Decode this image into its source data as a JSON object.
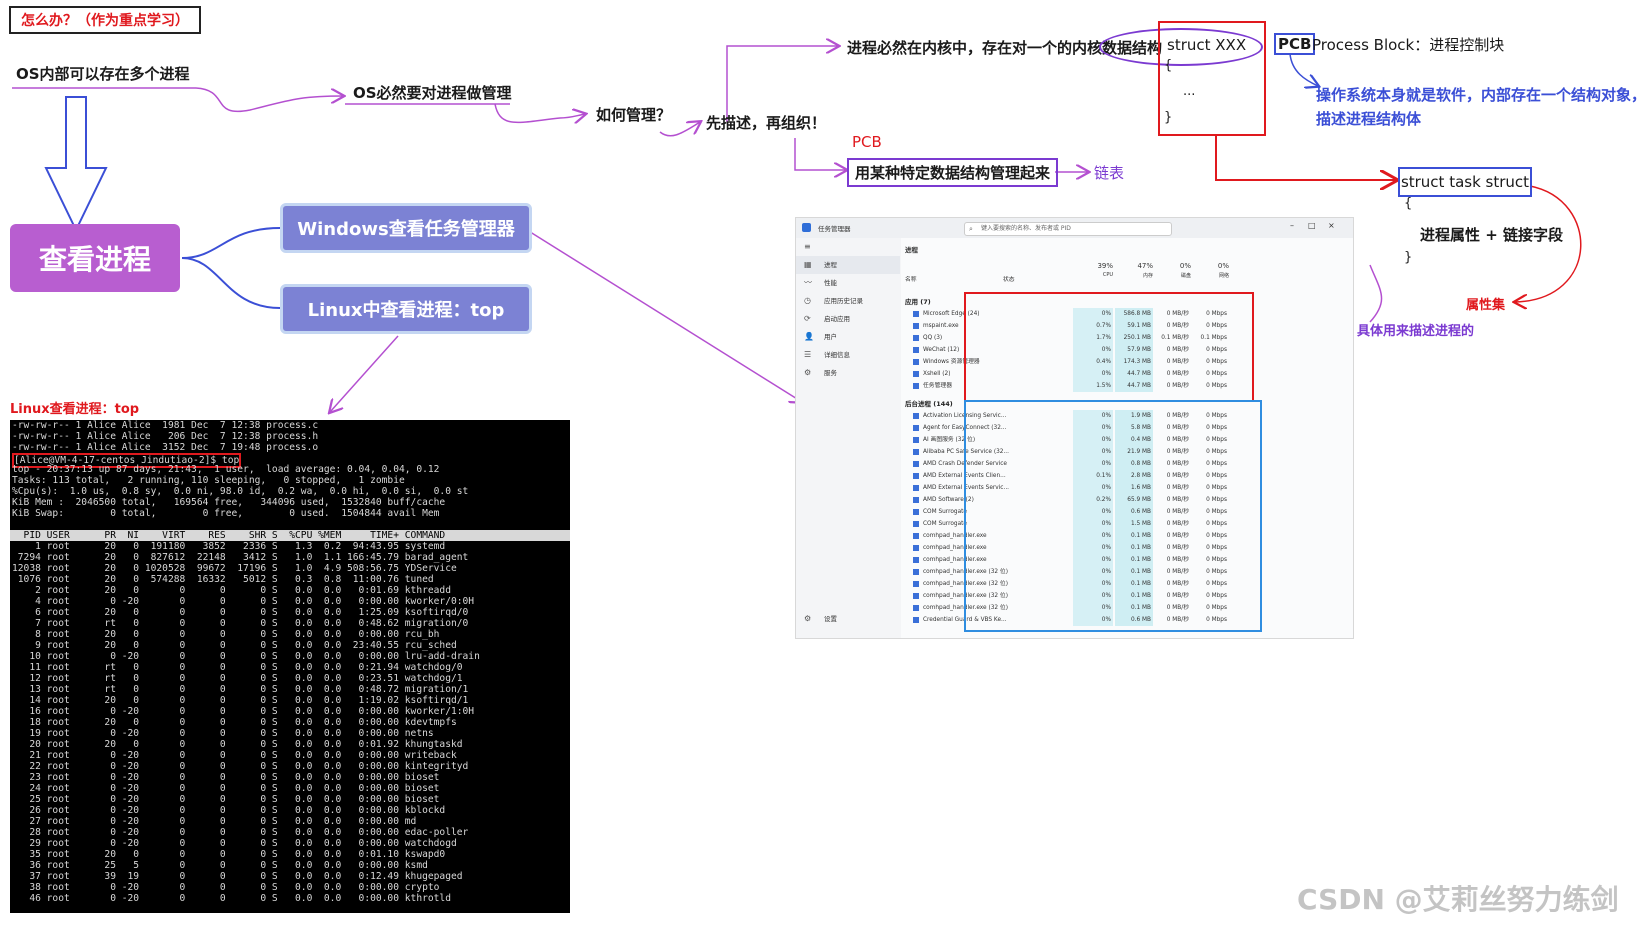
{
  "notes": {
    "title": "怎么办？（作为重点学习）",
    "os_multi": "OS内部可以存在多个进程",
    "os_manage": "OS必然要对进程做管理",
    "how_manage": "如何管理？",
    "describe_organize": "先描述，再组织！",
    "in_kernel": "进程必然在内核中，存在对一个的内核数据结构",
    "struct_xxx": "struct XXX",
    "struct_open": "{",
    "struct_dots": "...",
    "struct_close": "}",
    "pcb_label": "PCB",
    "pcb_desc": "Process Block：进程控制块",
    "os_software_1": "操作系统本身就是软件，内部存在一个结构对象，",
    "os_software_2": "描述进程结构体",
    "pcb_red": "PCB",
    "use_structure": "用某种特定数据结构管理起来",
    "linked_list": "链表",
    "task_struct": "struct task struct",
    "ts_open": "{",
    "ts_body": "进程属性 + 链接字段",
    "ts_close": "}",
    "attr_set": "属性集",
    "concrete_desc": "具体用来描述进程的",
    "view_process": "查看进程",
    "windows_tm": "Windows查看任务管理器",
    "linux_top": "Linux中查看进程：top",
    "linux_view_label": "Linux查看进程：top",
    "watermark": "CSDN @艾莉丝努力练剑"
  },
  "terminal": {
    "ls_lines": [
      "-rw-rw-r-- 1 Alice Alice  1981 Dec  7 12:38 process.c",
      "-rw-rw-r-- 1 Alice Alice   206 Dec  7 12:38 process.h",
      "-rw-rw-r-- 1 Alice Alice  3152 Dec  7 19:48 process.o"
    ],
    "prompt": "[Alice@VM-4-17-centos Jindutiao-2]$ top",
    "summary": [
      "top - 20:37:13 up 87 days, 21:43,  1 user,  load average: 0.04, 0.04, 0.12",
      "Tasks: 113 total,   2 running, 110 sleeping,   0 stopped,   1 zombie",
      "%Cpu(s):  1.0 us,  0.8 sy,  0.0 ni, 98.0 id,  0.2 wa,  0.0 hi,  0.0 si,  0.0 st",
      "KiB Mem :  2046500 total,   169564 free,   344096 used,  1532840 buff/cache",
      "KiB Swap:        0 total,        0 free,        0 used.  1504844 avail Mem"
    ],
    "header": "  PID USER      PR  NI    VIRT    RES    SHR S  %CPU %MEM     TIME+ COMMAND",
    "rows": [
      "    1 root      20   0  191180   3852   2336 S   1.3  0.2  94:43.95 systemd",
      " 7294 root      20   0  827612  22148   3412 S   1.0  1.1 166:45.79 barad_agent",
      "12038 root      20   0 1020528  99672  17196 S   1.0  4.9 508:56.75 YDService",
      " 1076 root      20   0  574288  16332   5012 S   0.3  0.8  11:00.76 tuned",
      "    2 root      20   0       0      0      0 S   0.0  0.0   0:01.69 kthreadd",
      "    4 root       0 -20       0      0      0 S   0.0  0.0   0:00.00 kworker/0:0H",
      "    6 root      20   0       0      0      0 S   0.0  0.0   1:25.09 ksoftirqd/0",
      "    7 root      rt   0       0      0      0 S   0.0  0.0   0:48.62 migration/0",
      "    8 root      20   0       0      0      0 S   0.0  0.0   0:00.00 rcu_bh",
      "    9 root      20   0       0      0      0 S   0.0  0.0  23:40.55 rcu_sched",
      "   10 root       0 -20       0      0      0 S   0.0  0.0   0:00.00 lru-add-drain",
      "   11 root      rt   0       0      0      0 S   0.0  0.0   0:21.94 watchdog/0",
      "   12 root      rt   0       0      0      0 S   0.0  0.0   0:23.51 watchdog/1",
      "   13 root      rt   0       0      0      0 S   0.0  0.0   0:48.72 migration/1",
      "   14 root      20   0       0      0      0 S   0.0  0.0   1:19.02 ksoftirqd/1",
      "   16 root       0 -20       0      0      0 S   0.0  0.0   0:00.00 kworker/1:0H",
      "   18 root      20   0       0      0      0 S   0.0  0.0   0:00.00 kdevtmpfs",
      "   19 root       0 -20       0      0      0 S   0.0  0.0   0:00.00 netns",
      "   20 root      20   0       0      0      0 S   0.0  0.0   0:01.92 khungtaskd",
      "   21 root       0 -20       0      0      0 S   0.0  0.0   0:00.00 writeback",
      "   22 root       0 -20       0      0      0 S   0.0  0.0   0:00.00 kintegrityd",
      "   23 root       0 -20       0      0      0 S   0.0  0.0   0:00.00 bioset",
      "   24 root       0 -20       0      0      0 S   0.0  0.0   0:00.00 bioset",
      "   25 root       0 -20       0      0      0 S   0.0  0.0   0:00.00 bioset",
      "   26 root       0 -20       0      0      0 S   0.0  0.0   0:00.00 kblockd",
      "   27 root       0 -20       0      0      0 S   0.0  0.0   0:00.00 md",
      "   28 root       0 -20       0      0      0 S   0.0  0.0   0:00.00 edac-poller",
      "   29 root       0 -20       0      0      0 S   0.0  0.0   0:00.00 watchdogd",
      "   35 root      20   0       0      0      0 S   0.0  0.0   0:01.10 kswapd0",
      "   36 root      25   5       0      0      0 S   0.0  0.0   0:00.00 ksmd",
      "   37 root      39  19       0      0      0 S   0.0  0.0   0:12.49 khugepaged",
      "   38 root       0 -20       0      0      0 S   0.0  0.0   0:00.00 crypto",
      "   46 root       0 -20       0      0      0 S   0.0  0.0   0:00.00 kthrotld"
    ]
  },
  "taskmgr": {
    "title": "任务管理器",
    "search_placeholder": "键入要搜索的名称、发布者或 PID",
    "side_items": [
      "进程",
      "性能",
      "应用历史记录",
      "启动应用",
      "用户",
      "详细信息",
      "服务"
    ],
    "settings": "设置",
    "tab": "进程",
    "col_name": "名称",
    "col_status": "状态",
    "cpu_pct": "39%",
    "mem_pct": "47%",
    "disk_pct": "0%",
    "net_pct": "0%",
    "cpu_label": "CPU",
    "mem_label": "内存",
    "disk_label": "磁盘",
    "net_label": "网络",
    "apps_section": "应用 (7)",
    "apps": [
      {
        "name": "Microsoft Edge (24)",
        "cpu": "0%",
        "mem": "586.8 MB",
        "disk": "0 MB/秒",
        "net": "0 Mbps"
      },
      {
        "name": "mspaint.exe",
        "cpu": "0.7%",
        "mem": "59.1 MB",
        "disk": "0 MB/秒",
        "net": "0 Mbps"
      },
      {
        "name": "QQ (3)",
        "cpu": "1.7%",
        "mem": "250.1 MB",
        "disk": "0.1 MB/秒",
        "net": "0.1 Mbps"
      },
      {
        "name": "WeChat (12)",
        "cpu": "0%",
        "mem": "57.9 MB",
        "disk": "0 MB/秒",
        "net": "0 Mbps"
      },
      {
        "name": "Windows 资源管理器",
        "cpu": "0.4%",
        "mem": "174.3 MB",
        "disk": "0 MB/秒",
        "net": "0 Mbps"
      },
      {
        "name": "Xshell (2)",
        "cpu": "0%",
        "mem": "44.7 MB",
        "disk": "0 MB/秒",
        "net": "0 Mbps"
      },
      {
        "name": "任务管理器",
        "cpu": "1.5%",
        "mem": "44.7 MB",
        "disk": "0 MB/秒",
        "net": "0 Mbps"
      }
    ],
    "bg_section": "后台进程 (144)",
    "bg": [
      {
        "name": "Activation Licensing Servic...",
        "cpu": "0%",
        "mem": "1.9 MB",
        "disk": "0 MB/秒",
        "net": "0 Mbps"
      },
      {
        "name": "Agent for EasyConnect (32...",
        "cpu": "0%",
        "mem": "5.8 MB",
        "disk": "0 MB/秒",
        "net": "0 Mbps"
      },
      {
        "name": "AI 画图服务 (32 位)",
        "cpu": "0%",
        "mem": "0.4 MB",
        "disk": "0 MB/秒",
        "net": "0 Mbps"
      },
      {
        "name": "Alibaba PC Safe Service (32...",
        "cpu": "0%",
        "mem": "21.9 MB",
        "disk": "0 MB/秒",
        "net": "0 Mbps"
      },
      {
        "name": "AMD Crash Defender Service",
        "cpu": "0%",
        "mem": "0.8 MB",
        "disk": "0 MB/秒",
        "net": "0 Mbps"
      },
      {
        "name": "AMD External Events Clien...",
        "cpu": "0.1%",
        "mem": "2.8 MB",
        "disk": "0 MB/秒",
        "net": "0 Mbps"
      },
      {
        "name": "AMD External Events Servic...",
        "cpu": "0%",
        "mem": "1.6 MB",
        "disk": "0 MB/秒",
        "net": "0 Mbps"
      },
      {
        "name": "AMD Software (2)",
        "cpu": "0.2%",
        "mem": "65.9 MB",
        "disk": "0 MB/秒",
        "net": "0 Mbps"
      },
      {
        "name": "COM Surrogate",
        "cpu": "0%",
        "mem": "0.6 MB",
        "disk": "0 MB/秒",
        "net": "0 Mbps"
      },
      {
        "name": "COM Surrogate",
        "cpu": "0%",
        "mem": "1.5 MB",
        "disk": "0 MB/秒",
        "net": "0 Mbps"
      },
      {
        "name": "comhpad_handler.exe",
        "cpu": "0%",
        "mem": "0.1 MB",
        "disk": "0 MB/秒",
        "net": "0 Mbps"
      },
      {
        "name": "comhpad_handler.exe",
        "cpu": "0%",
        "mem": "0.1 MB",
        "disk": "0 MB/秒",
        "net": "0 Mbps"
      },
      {
        "name": "comhpad_handler.exe",
        "cpu": "0%",
        "mem": "0.1 MB",
        "disk": "0 MB/秒",
        "net": "0 Mbps"
      },
      {
        "name": "comhpad_handler.exe (32 位)",
        "cpu": "0%",
        "mem": "0.1 MB",
        "disk": "0 MB/秒",
        "net": "0 Mbps"
      },
      {
        "name": "comhpad_handler.exe (32 位)",
        "cpu": "0%",
        "mem": "0.1 MB",
        "disk": "0 MB/秒",
        "net": "0 Mbps"
      },
      {
        "name": "comhpad_handler.exe (32 位)",
        "cpu": "0%",
        "mem": "0.1 MB",
        "disk": "0 MB/秒",
        "net": "0 Mbps"
      },
      {
        "name": "comhpad_handler.exe (32 位)",
        "cpu": "0%",
        "mem": "0.1 MB",
        "disk": "0 MB/秒",
        "net": "0 Mbps"
      },
      {
        "name": "Credential Guard & VBS Ke...",
        "cpu": "0%",
        "mem": "0.6 MB",
        "disk": "0 MB/秒",
        "net": "0 Mbps"
      }
    ]
  },
  "colors": {
    "purple_arrow": "#b450d0",
    "red_arrow": "#e0191e",
    "blue_arrow": "#3b4fd6",
    "pill_main": "#b85ed0",
    "pill_sub": "#7c82d4"
  }
}
